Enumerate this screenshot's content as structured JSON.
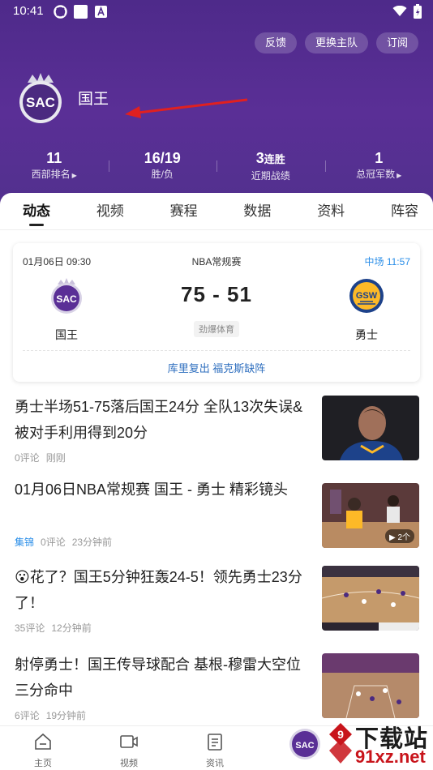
{
  "status_bar": {
    "time": "10:41"
  },
  "header": {
    "actions": [
      "反馈",
      "更换主队",
      "订阅"
    ],
    "team_name": "国王",
    "team_logo_text": "SAC",
    "stats": [
      {
        "value": "11",
        "value_suffix": "",
        "label": "西部排名",
        "has_arrow": true
      },
      {
        "value": "16/19",
        "value_suffix": "",
        "label": "胜/负",
        "has_arrow": false
      },
      {
        "value": "3",
        "value_suffix": "连胜",
        "label": "近期战绩",
        "has_arrow": false
      },
      {
        "value": "1",
        "value_suffix": "",
        "label": "总冠军数",
        "has_arrow": true
      }
    ]
  },
  "tabs": [
    "动态",
    "视频",
    "赛程",
    "数据",
    "资料",
    "阵容"
  ],
  "active_tab": 0,
  "match": {
    "date": "01月06日 09:30",
    "league": "NBA常规赛",
    "status": "中场 11:57",
    "home_name": "国王",
    "home_logo_text": "SAC",
    "away_name": "勇士",
    "away_logo_text": "GSW",
    "score": "75 - 51",
    "source": "劲爆体育",
    "headline": "库里复出 福克斯缺阵"
  },
  "news": [
    {
      "title": "勇士半场51-75落后国王24分 全队13次失误&被对手利用得到20分",
      "tag": "",
      "comments": "0评论",
      "time": "刚刚",
      "badge": ""
    },
    {
      "title": "01月06日NBA常规赛 国王 - 勇士 精彩镜头",
      "tag": "集锦",
      "comments": "0评论",
      "time": "23分钟前",
      "badge": "2个"
    },
    {
      "title": "😮花了？国王5分钟狂轰24-5！领先勇士23分了！",
      "tag": "",
      "comments": "35评论",
      "time": "12分钟前",
      "badge": ""
    },
    {
      "title": "射停勇士！国王传导球配合 基根-穆雷大空位三分命中",
      "tag": "",
      "comments": "6评论",
      "time": "19分钟前",
      "badge": ""
    }
  ],
  "bottom_nav": [
    "主页",
    "视频",
    "资讯"
  ],
  "watermark": {
    "line1": "下载站",
    "line2": "91xz.net"
  },
  "colors": {
    "header_purple": "#5a2f96",
    "accent_blue": "#2a8ee8",
    "score_link": "#2f6fbf",
    "annotation_red": "#e02020"
  }
}
